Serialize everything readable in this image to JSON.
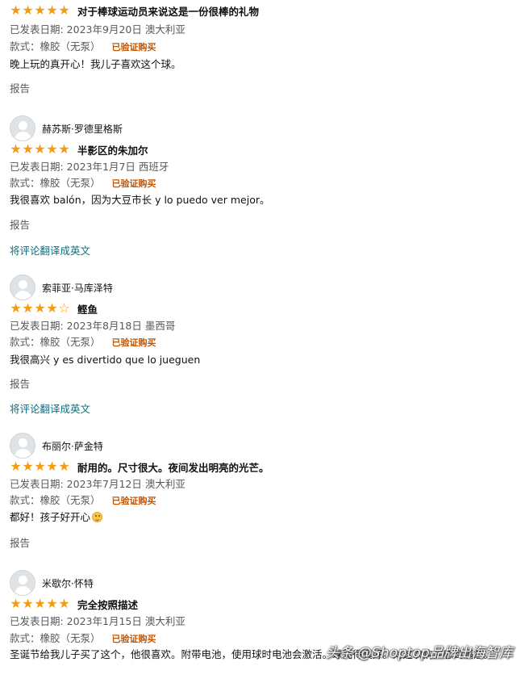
{
  "labels": {
    "report": "报告",
    "translate": "将评论翻译成英文",
    "verified": "已验证购买"
  },
  "reviews": [
    {
      "reviewer": "",
      "rating": 5,
      "title": "对于棒球运动员来说这是一份很棒的礼物",
      "date_location": "已发表日期: 2023年9月20日 澳大利亚",
      "style": "款式：橡胶（无泵）",
      "text": "晚上玩的真开心！我儿子喜欢这个球。",
      "has_translate": false
    },
    {
      "reviewer": "赫苏斯·罗德里格斯",
      "rating": 5,
      "title": "半影区的朱加尔",
      "date_location": "已发表日期: 2023年1月7日 西班牙",
      "style": "款式：橡胶（无泵）",
      "text": "我很喜欢 balón，因为大豆市长 y lo puedo ver mejor。",
      "has_translate": true
    },
    {
      "reviewer": "索菲亚·马库泽特",
      "rating": 4,
      "title": "鲣鱼",
      "date_location": "已发表日期: 2023年8月18日 墨西哥",
      "style": "款式：橡胶（无泵）",
      "text": "我很高兴 y es divertido que lo jueguen",
      "has_translate": true
    },
    {
      "reviewer": "布丽尔·萨金特",
      "rating": 5,
      "title": "耐用的。尺寸很大。夜间发出明亮的光芒。",
      "date_location": "已发表日期: 2023年7月12日 澳大利亚",
      "style": "款式：橡胶（无泵）",
      "text": "都好！孩子好开心",
      "has_translate": false
    },
    {
      "reviewer": "米歇尔·怀特",
      "rating": 5,
      "title": "完全按照描述",
      "date_location": "已发表日期: 2023年1月15日 澳大利亚",
      "style": "款式：橡胶（无泵）",
      "text": "圣诞节给我儿子买了这个，他很喜欢。附带电池，使用球时电池会激活。球亮得真好。对这次购买感到满意。",
      "has_translate": false
    }
  ],
  "watermark": "头条 @Shoptop品牌出海智库",
  "colors": {
    "star": "#f39c12",
    "link": "#007185",
    "verified": "#c45500",
    "meta": "#565959"
  },
  "icons": {
    "avatar": "default-avatar-icon",
    "star": "star-icon",
    "emoji": "smiling-face-icon"
  }
}
